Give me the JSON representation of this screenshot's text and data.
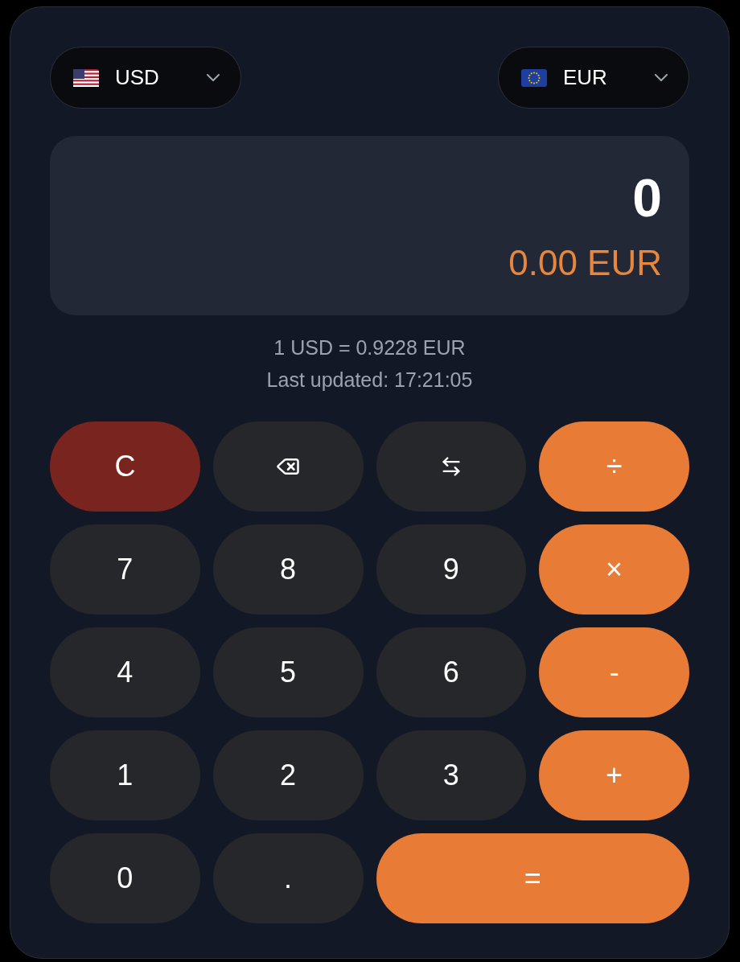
{
  "currencies": [
    {
      "code": "USD",
      "kind": "us"
    },
    {
      "code": "EUR",
      "kind": "eu"
    }
  ],
  "display": {
    "input": "0",
    "result": "0.00 EUR"
  },
  "rate": "1 USD = 0.9228 EUR",
  "last_updated": "Last updated: 17:21:05",
  "keys": [
    {
      "kind": "clear",
      "label": "C"
    },
    {
      "kind": "backspace"
    },
    {
      "kind": "swap"
    },
    {
      "kind": "operator",
      "label": "÷"
    },
    {
      "kind": "digit",
      "label": "7"
    },
    {
      "kind": "digit",
      "label": "8"
    },
    {
      "kind": "digit",
      "label": "9"
    },
    {
      "kind": "operator",
      "label": "×"
    },
    {
      "kind": "digit",
      "label": "4"
    },
    {
      "kind": "digit",
      "label": "5"
    },
    {
      "kind": "digit",
      "label": "6"
    },
    {
      "kind": "operator",
      "label": "-"
    },
    {
      "kind": "digit",
      "label": "1"
    },
    {
      "kind": "digit",
      "label": "2"
    },
    {
      "kind": "digit",
      "label": "3"
    },
    {
      "kind": "operator",
      "label": "+"
    },
    {
      "kind": "digit",
      "label": "0"
    },
    {
      "kind": "digit",
      "label": "."
    },
    {
      "kind": "equals",
      "label": "="
    }
  ]
}
